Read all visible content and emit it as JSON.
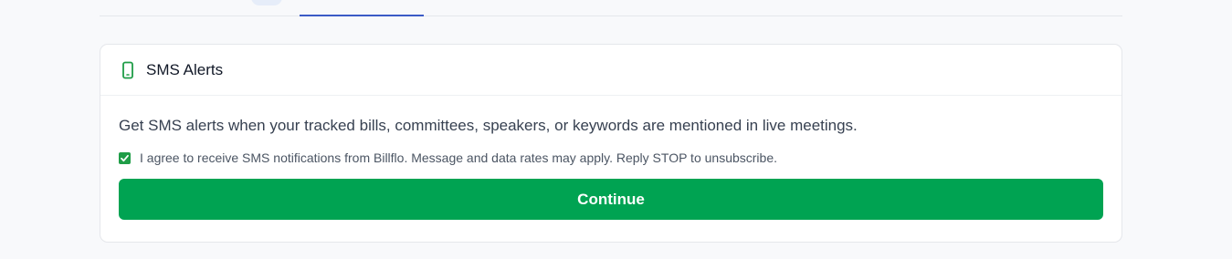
{
  "colors": {
    "accent_green": "#00a352",
    "checkbox_green": "#1f9d47",
    "tab_active_blue": "#3b5bc6",
    "icon_green": "#1f9d47"
  },
  "sms_card": {
    "icon": "phone-icon",
    "title": "SMS Alerts",
    "description": "Get SMS alerts when your tracked bills, committees, speakers, or keywords are mentioned in live meetings.",
    "consent_checked": true,
    "consent_text": "I agree to receive SMS notifications from Billflo. Message and data rates may apply. Reply STOP to unsubscribe.",
    "continue_label": "Continue"
  }
}
